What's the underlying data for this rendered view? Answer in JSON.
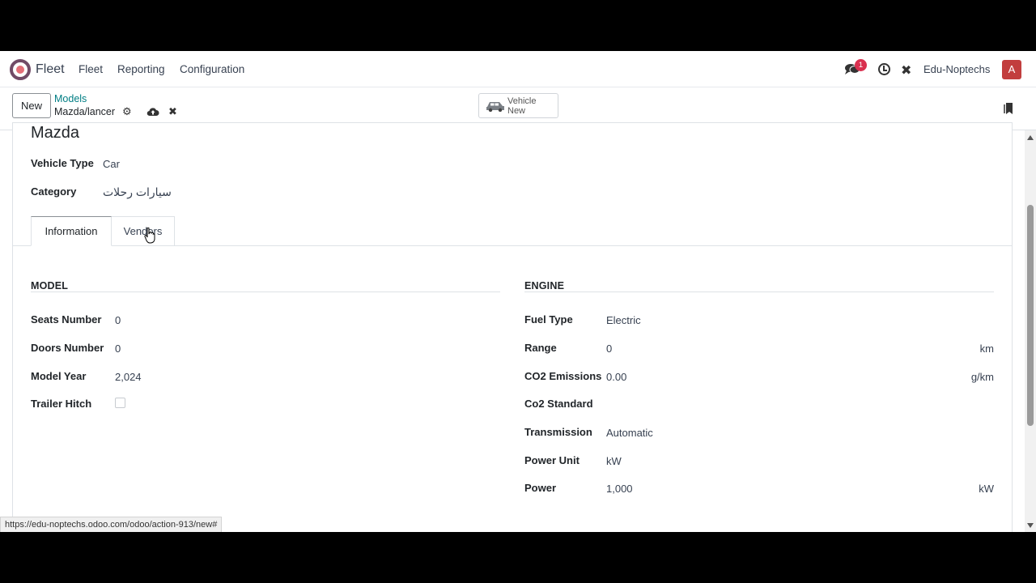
{
  "navbar": {
    "app_name": "Fleet",
    "menu": [
      "Fleet",
      "Reporting",
      "Configuration"
    ],
    "notification_count": "1",
    "company": "Edu-Noptechs",
    "avatar_letter": "A",
    "icons": [
      "app-logo-icon",
      "chat-icon",
      "clock-icon",
      "tools-icon"
    ]
  },
  "control_panel": {
    "new_label": "New",
    "breadcrumb_parent": "Models",
    "breadcrumb_current": "Mazda/lancer",
    "smart_button": {
      "line1": "Vehicle",
      "line2": "New"
    }
  },
  "form": {
    "brand_title": "Mazda",
    "vehicle_type_label": "Vehicle Type",
    "vehicle_type_value": "Car",
    "category_label": "Category",
    "category_value": "سيارات رحلات",
    "tabs": [
      "Information",
      "Vendors"
    ],
    "model_group": {
      "title": "MODEL",
      "fields": [
        {
          "label": "Seats Number",
          "value": "0"
        },
        {
          "label": "Doors Number",
          "value": "0"
        },
        {
          "label": "Model Year",
          "value": "2,024"
        },
        {
          "label": "Trailer Hitch",
          "value": ""
        }
      ]
    },
    "engine_group": {
      "title": "ENGINE",
      "fields": [
        {
          "label": "Fuel Type",
          "value": "Electric",
          "unit": ""
        },
        {
          "label": "Range",
          "value": "0",
          "unit": "km"
        },
        {
          "label": "CO2 Emissions",
          "value": "0.00",
          "unit": "g/km"
        },
        {
          "label": "Co2 Standard",
          "value": "",
          "unit": ""
        },
        {
          "label": "Transmission",
          "value": "Automatic",
          "unit": ""
        },
        {
          "label": "Power Unit",
          "value": "kW",
          "unit": ""
        },
        {
          "label": "Power",
          "value": "1,000",
          "unit": "kW"
        }
      ]
    }
  },
  "status_url": "https://edu-noptechs.odoo.com/odoo/action-913/new#",
  "colors": {
    "brand": "#714B67",
    "link": "#017e84",
    "badge": "#d9304f",
    "avatar": "#c23e3e"
  }
}
